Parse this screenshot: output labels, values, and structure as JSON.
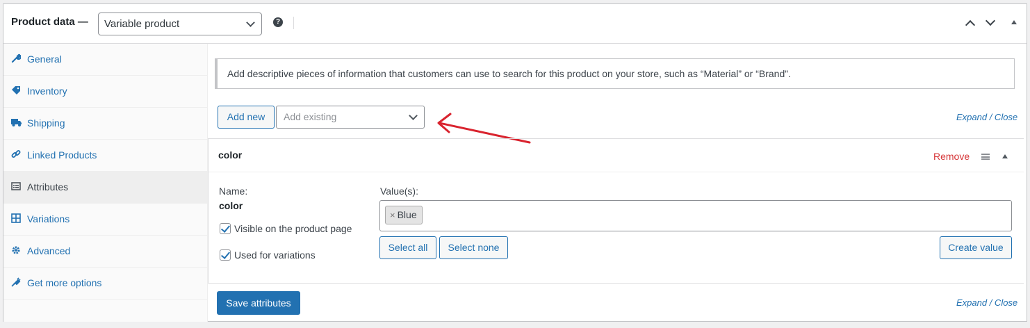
{
  "header": {
    "title": "Product data —",
    "product_type": "Variable product",
    "help_glyph": "?"
  },
  "sidebar": {
    "items": [
      {
        "label": "General",
        "icon": "wrench-icon"
      },
      {
        "label": "Inventory",
        "icon": "tag-icon"
      },
      {
        "label": "Shipping",
        "icon": "truck-icon"
      },
      {
        "label": "Linked Products",
        "icon": "link-icon"
      },
      {
        "label": "Attributes",
        "icon": "list-icon",
        "active": true
      },
      {
        "label": "Variations",
        "icon": "grid-icon"
      },
      {
        "label": "Advanced",
        "icon": "gear-icon"
      },
      {
        "label": "Get more options",
        "icon": "plug-icon"
      }
    ]
  },
  "main": {
    "notice": "Add descriptive pieces of information that customers can use to search for this product on your store, such as “Material” or “Brand”.",
    "add_new_label": "Add new",
    "add_existing_placeholder": "Add existing",
    "expand_close": "Expand / Close",
    "attribute": {
      "name": "color",
      "remove_label": "Remove",
      "name_label": "Name:",
      "name_value": "color",
      "visible_label": "Visible on the product page",
      "visible_checked": true,
      "variations_label": "Used for variations",
      "variations_checked": true,
      "values_label": "Value(s):",
      "values": [
        "Blue"
      ],
      "select_all": "Select all",
      "select_none": "Select none",
      "create_value": "Create value"
    },
    "save_label": "Save attributes",
    "expand_close_bottom": "Expand / Close"
  },
  "colors": {
    "link": "#2271b1",
    "remove": "#d63638",
    "arrow": "#d9232e",
    "primary_button": "#2271b1"
  }
}
